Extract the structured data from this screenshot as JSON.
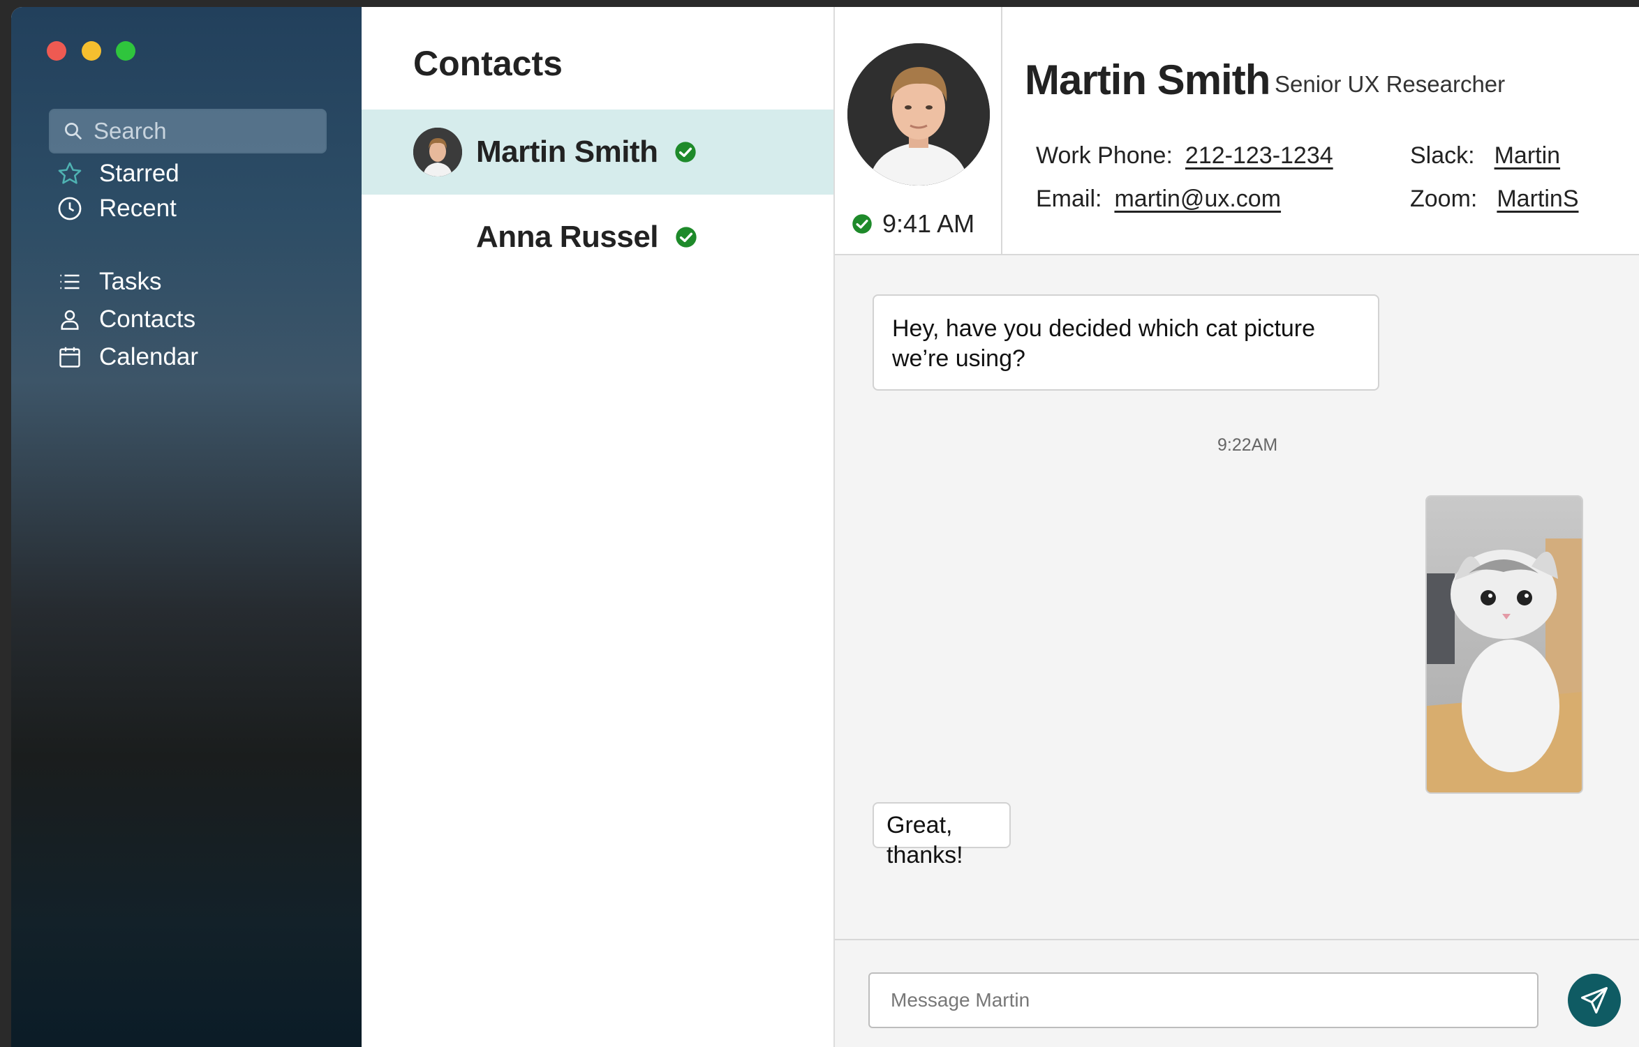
{
  "window": {
    "controls": [
      "close",
      "minimize",
      "zoom"
    ]
  },
  "sidebar": {
    "search": {
      "placeholder": "Search"
    },
    "items": [
      {
        "label": "Starred",
        "icon": "star-icon"
      },
      {
        "label": "Recent",
        "icon": "clock-icon"
      },
      {
        "label": "Tasks",
        "icon": "list-icon"
      },
      {
        "label": "Contacts",
        "icon": "person-icon"
      },
      {
        "label": "Calendar",
        "icon": "calendar-icon"
      }
    ]
  },
  "contacts": {
    "title": "Contacts",
    "list": [
      {
        "name": "Martin Smith",
        "status": "online",
        "selected": true
      },
      {
        "name": "Anna Russel",
        "status": "online",
        "selected": false
      }
    ]
  },
  "profile": {
    "name": "Martin Smith",
    "title": "Senior UX Researcher",
    "local_time": "9:41 AM",
    "work_phone_label": "Work Phone:",
    "work_phone": "212-123-1234",
    "email_label": "Email:",
    "email": "martin@ux.com",
    "slack_label": "Slack:",
    "slack": "Martin",
    "zoom_label": "Zoom:",
    "zoom": "MartinS"
  },
  "chat": {
    "messages": [
      {
        "text": "Hey, have you decided which cat picture we’re using?"
      },
      {
        "timestamp": "9:22AM"
      },
      {
        "type": "image",
        "subject": "kitten photo"
      },
      {
        "text": "Great, thanks!"
      }
    ],
    "composer": {
      "placeholder": "Message Martin"
    }
  },
  "colors": {
    "accent": "#0f5b63",
    "selected_row": "#d6ecec",
    "status_online": "#1e8a2a",
    "star_teal": "#4fb3b3"
  }
}
